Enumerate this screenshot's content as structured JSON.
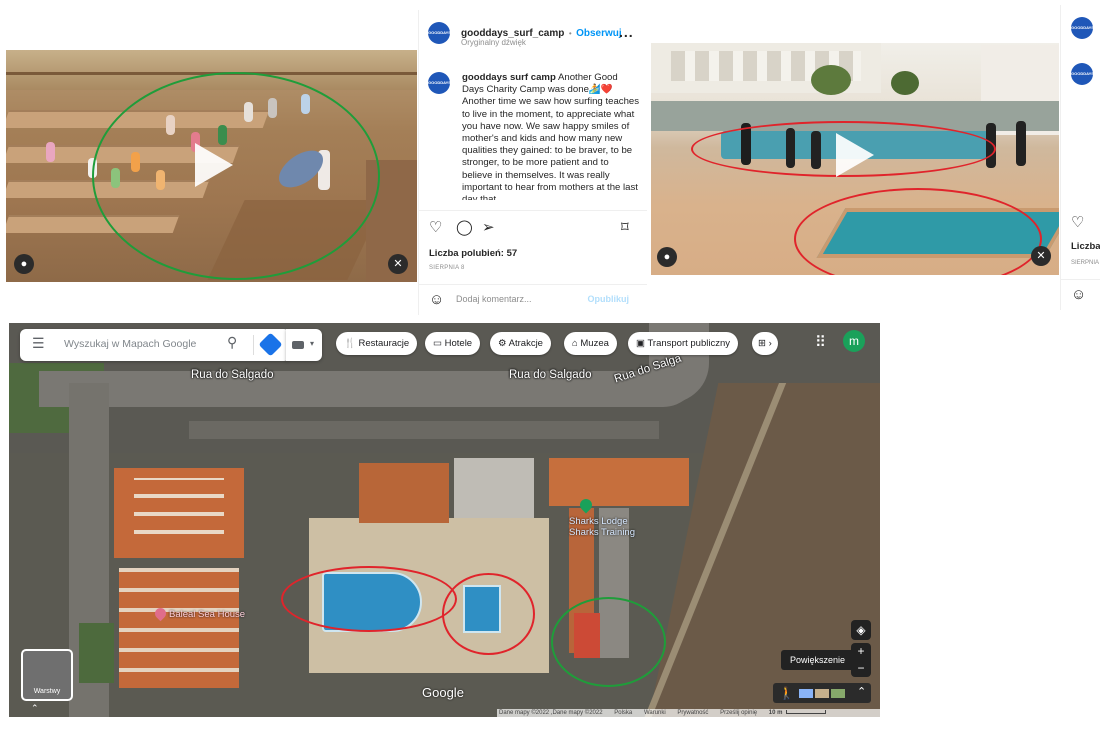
{
  "post1": {
    "username": "gooddays_surf_camp",
    "dot": "•",
    "follow": "Obserwuj",
    "audio": "Oryginalny dźwięk",
    "more": "...",
    "caption_user": "gooddays surf camp",
    "caption_text": "Another Good Days Charity Camp was done🏄❤️ Another time we saw how surfing teaches to live in the moment, to appreciate what you have now. We saw happy smiles of mother's and kids and how many new qualities they gained: to be braver, to be stronger, to be more patient and to believe in themselves. It was really important to hear from mothers at the last day that",
    "likes": "Liczba polubień: 57",
    "date": "SIERPNIA 8",
    "comment_placeholder": "Dodaj komentarz...",
    "publish": "Opublikuj"
  },
  "post2": {
    "likes": "Liczba",
    "date": "SIERPNIA"
  },
  "map": {
    "search_placeholder": "Wyszukaj w Mapach Google",
    "categories": [
      "Restauracje",
      "Hotele",
      "Atrakcje",
      "Muzea",
      "Transport publiczny"
    ],
    "profile_initial": "m",
    "streets": [
      "Rua do Salgado",
      "Rua do Salgado",
      "Rua do Salga"
    ],
    "poi_lodge": "Sharks Lodge",
    "poi_training": "Sharks Training",
    "poi_house": "Baleal Sea House",
    "google": "Google",
    "layers": "Warstwy",
    "zoom_tooltip": "Powiększenie",
    "zoom_in": "+",
    "zoom_out": "−",
    "footer_data": "Dane mapy ©2022 ,Dane mapy ©2022",
    "footer_links": [
      "Polska",
      "Warunki",
      "Prywatność",
      "Prześlij opinię"
    ],
    "scale": "10 m"
  },
  "colors": {
    "follow": "#0095f6",
    "avatar": "#1f57b8",
    "map_accent": "#1aa15a",
    "circle_red": "#e0242b",
    "circle_green": "#1f9d3a"
  }
}
